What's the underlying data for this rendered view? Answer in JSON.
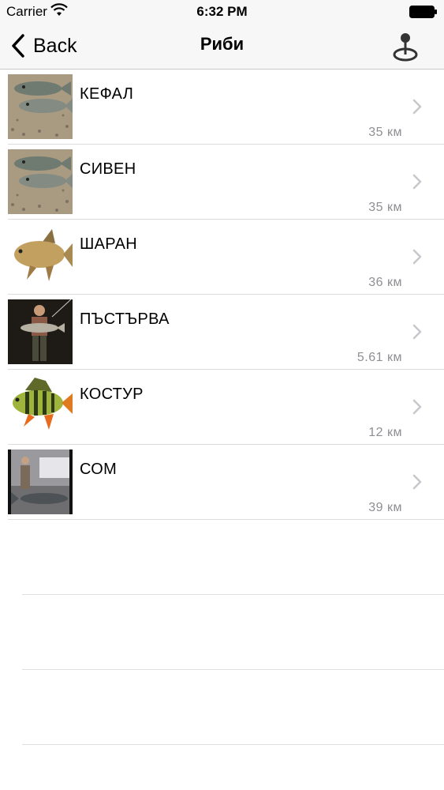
{
  "status_bar": {
    "carrier": "Carrier",
    "time": "6:32 PM",
    "wifi_icon": "wifi-icon",
    "battery_icon": "battery-icon"
  },
  "nav": {
    "back_label": "Back",
    "title": "Риби",
    "map_icon": "map-pin-icon"
  },
  "fish": [
    {
      "name": "КЕФАЛ",
      "distance": "35 км",
      "image": "two-grey-fish-photo"
    },
    {
      "name": "СИВЕН",
      "distance": "35 км",
      "image": "two-grey-fish-photo"
    },
    {
      "name": "ШАРАН",
      "distance": "36 км",
      "image": "carp-photo"
    },
    {
      "name": "ПЪСТЪРВА",
      "distance": "5.61 км",
      "image": "angler-with-trout-photo"
    },
    {
      "name": "КОСТУР",
      "distance": "12 км",
      "image": "perch-photo"
    },
    {
      "name": "СОМ",
      "distance": "39 км",
      "image": "angler-with-catfish-photo"
    }
  ]
}
